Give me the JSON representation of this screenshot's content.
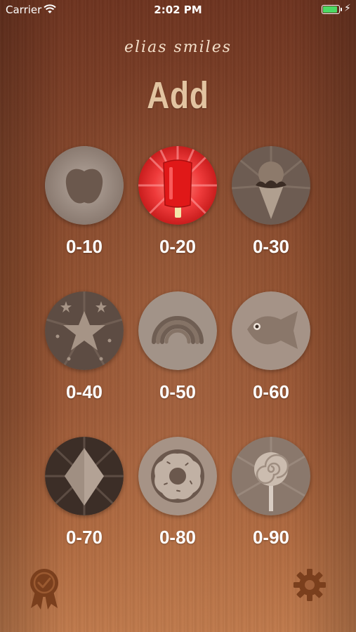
{
  "status_bar": {
    "carrier": "Carrier",
    "time": "2:02 PM",
    "battery_level": 0.9
  },
  "header": {
    "brand": "elias smiles",
    "title": "Add"
  },
  "levels": [
    {
      "label": "0-10",
      "icon": "apple-icon",
      "selected": false
    },
    {
      "label": "0-20",
      "icon": "popsicle-icon",
      "selected": true
    },
    {
      "label": "0-30",
      "icon": "ice-cream-cone-icon",
      "selected": false
    },
    {
      "label": "0-40",
      "icon": "star-icon",
      "selected": false
    },
    {
      "label": "0-50",
      "icon": "rainbow-icon",
      "selected": false
    },
    {
      "label": "0-60",
      "icon": "fish-icon",
      "selected": false
    },
    {
      "label": "0-70",
      "icon": "diamond-icon",
      "selected": false
    },
    {
      "label": "0-80",
      "icon": "donut-icon",
      "selected": false
    },
    {
      "label": "0-90",
      "icon": "lollipop-icon",
      "selected": false
    }
  ],
  "footer": {
    "left_icon": "award-ribbon-icon",
    "right_icon": "gear-icon"
  },
  "colors": {
    "accent_red": "#e53935",
    "label_text": "#ffffff",
    "title_text": "#e2c4a1",
    "badge_muted": "#9c8b80"
  }
}
